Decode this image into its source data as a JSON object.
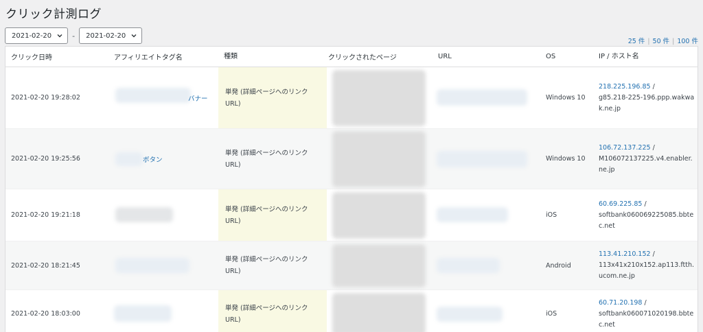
{
  "title": "クリック計測ログ",
  "filter": {
    "from": "2021-02-20",
    "separator": "-",
    "to": "2021-02-20"
  },
  "per_page": {
    "opt25": "25 件",
    "opt50": "50 件",
    "opt100": "100 件",
    "sep": "|"
  },
  "columns": {
    "date": "クリック日時",
    "tag": "アフィリエイトタグ名",
    "type": "種類",
    "page": "クリックされたページ",
    "url": "URL",
    "os": "OS",
    "ip": "IP / ホスト名"
  },
  "rows": [
    {
      "date": "2021-02-20 19:28:02",
      "tag": "バナー",
      "type": "単発 (詳細ページへのリンクURL)",
      "os": "Windows 10",
      "ip": "218.225.196.85",
      "ip_sep": " /",
      "host": "g85.218-225-196.ppp.wakwak.ne.jp"
    },
    {
      "date": "2021-02-20 19:25:56",
      "tag": "ボタン",
      "type": "単発 (詳細ページへのリンクURL)",
      "os": "Windows 10",
      "ip": "106.72.137.225",
      "ip_sep": " /",
      "host": "M106072137225.v4.enabler.ne.jp"
    },
    {
      "date": "2021-02-20 19:21:18",
      "tag": "",
      "type": "単発 (詳細ページへのリンクURL)",
      "os": "iOS",
      "ip": "60.69.225.85",
      "ip_sep": " /",
      "host": "softbank060069225085.bbtec.net"
    },
    {
      "date": "2021-02-20 18:21:45",
      "tag": "",
      "type": "単発 (詳細ページへのリンクURL)",
      "os": "Android",
      "ip": "113.41.210.152",
      "ip_sep": " /",
      "host": "113x41x210x152.ap113.ftth.ucom.ne.jp"
    },
    {
      "date": "2021-02-20 18:03:00",
      "tag": "",
      "type": "単発 (詳細ページへのリンクURL)",
      "os": "iOS",
      "ip": "60.71.20.198",
      "ip_sep": " /",
      "host": "softbank060071020198.bbtec.net"
    }
  ],
  "icons": {
    "dropdown": "chevron-down-icon"
  },
  "colors": {
    "link": "#2271b1",
    "type_column_bg": "#f9f9e3",
    "background": "#f0f0f1"
  }
}
